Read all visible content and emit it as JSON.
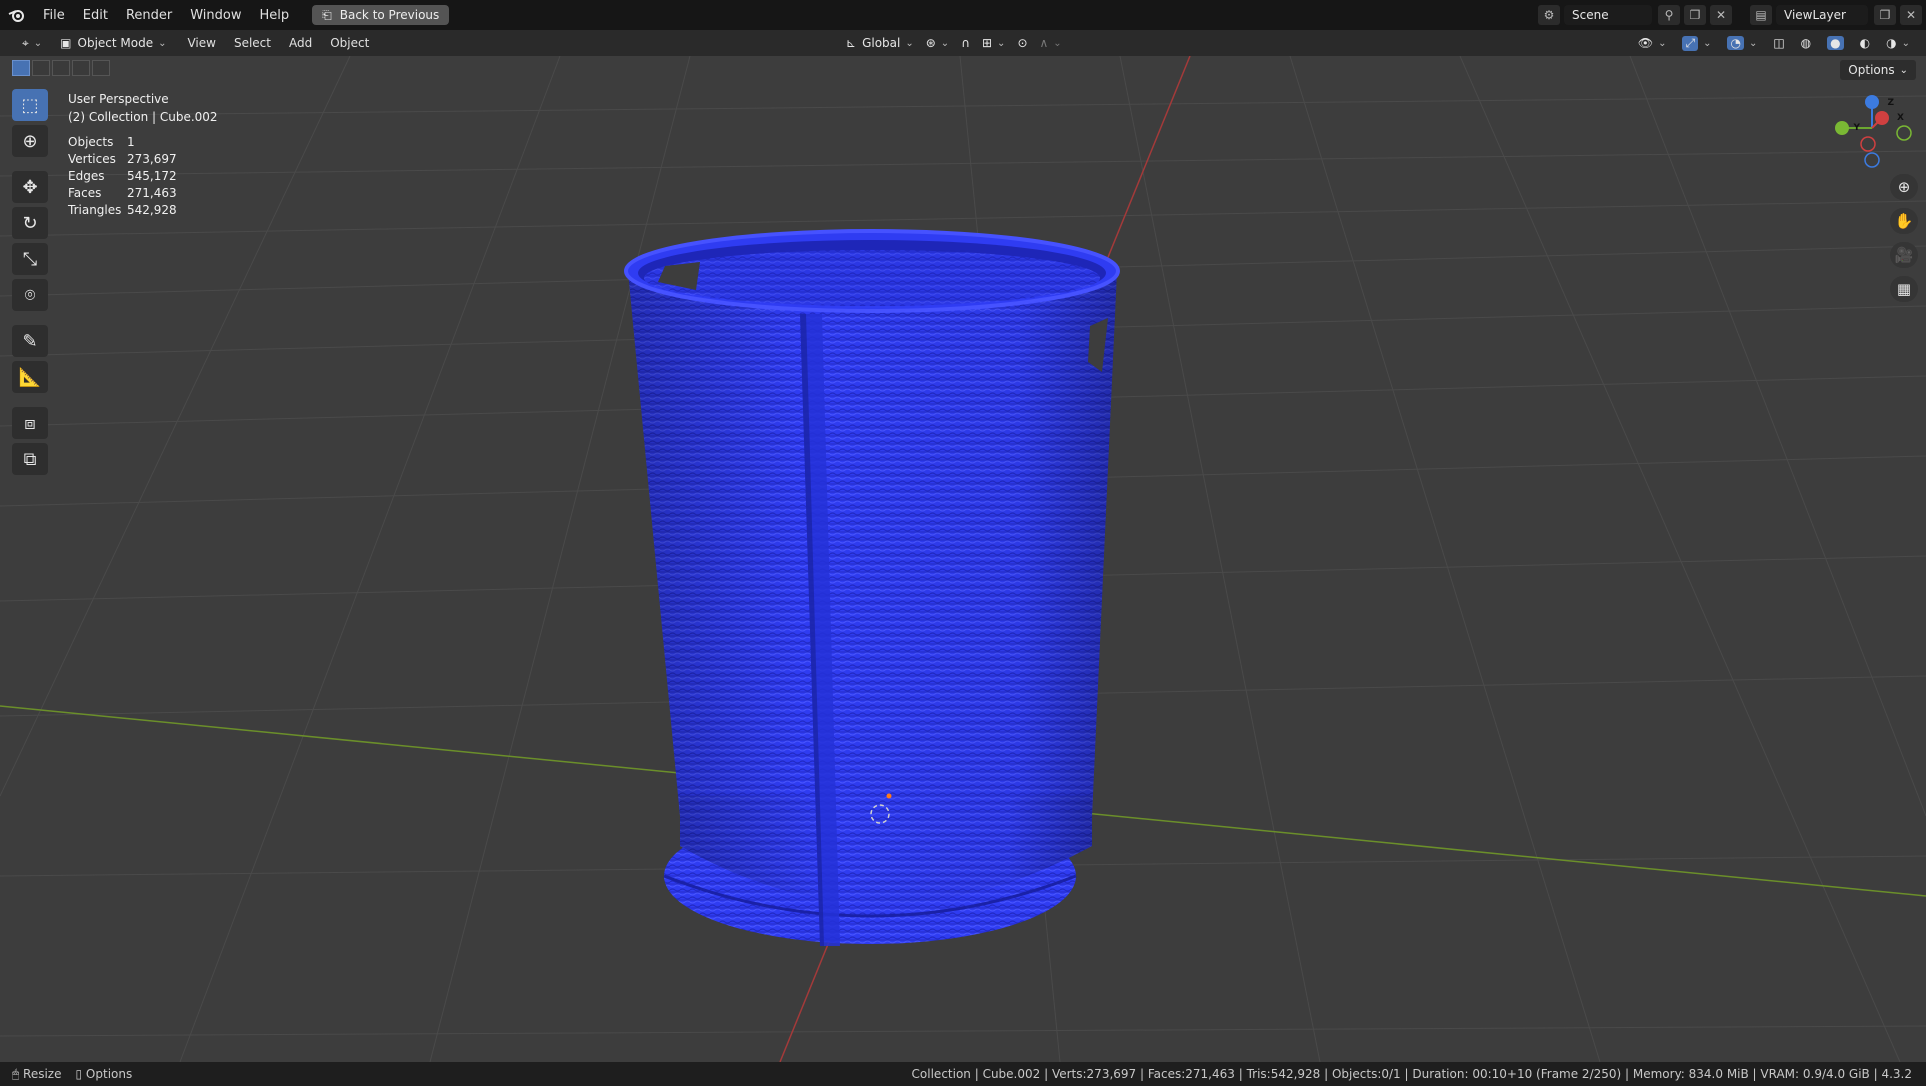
{
  "topbar": {
    "menu": [
      "File",
      "Edit",
      "Render",
      "Window",
      "Help"
    ],
    "back_button": "Back to Previous",
    "scene": "Scene",
    "view_layer": "ViewLayer"
  },
  "header": {
    "mode": "Object Mode",
    "menus": [
      "View",
      "Select",
      "Add",
      "Object"
    ],
    "orientation": "Global",
    "options": "Options"
  },
  "viewport": {
    "perspective": "User Perspective",
    "collection": "(2) Collection | Cube.002",
    "stats": [
      {
        "label": "Objects",
        "value": "1"
      },
      {
        "label": "Vertices",
        "value": "273,697"
      },
      {
        "label": "Edges",
        "value": "545,172"
      },
      {
        "label": "Faces",
        "value": "271,463"
      },
      {
        "label": "Triangles",
        "value": "542,928"
      }
    ],
    "gizmo": {
      "x": "X",
      "y": "Y",
      "z": "Z"
    },
    "object_color": "#2e3cf0"
  },
  "statusbar": {
    "resize": "Resize",
    "options": "Options",
    "info": "Collection | Cube.002 | Verts:273,697 | Faces:271,463 | Tris:542,928 | Objects:0/1 | Duration: 00:10+10 (Frame 2/250) | Memory: 834.0 MiB | VRAM: 0.9/4.0 GiB | 4.3.2"
  }
}
